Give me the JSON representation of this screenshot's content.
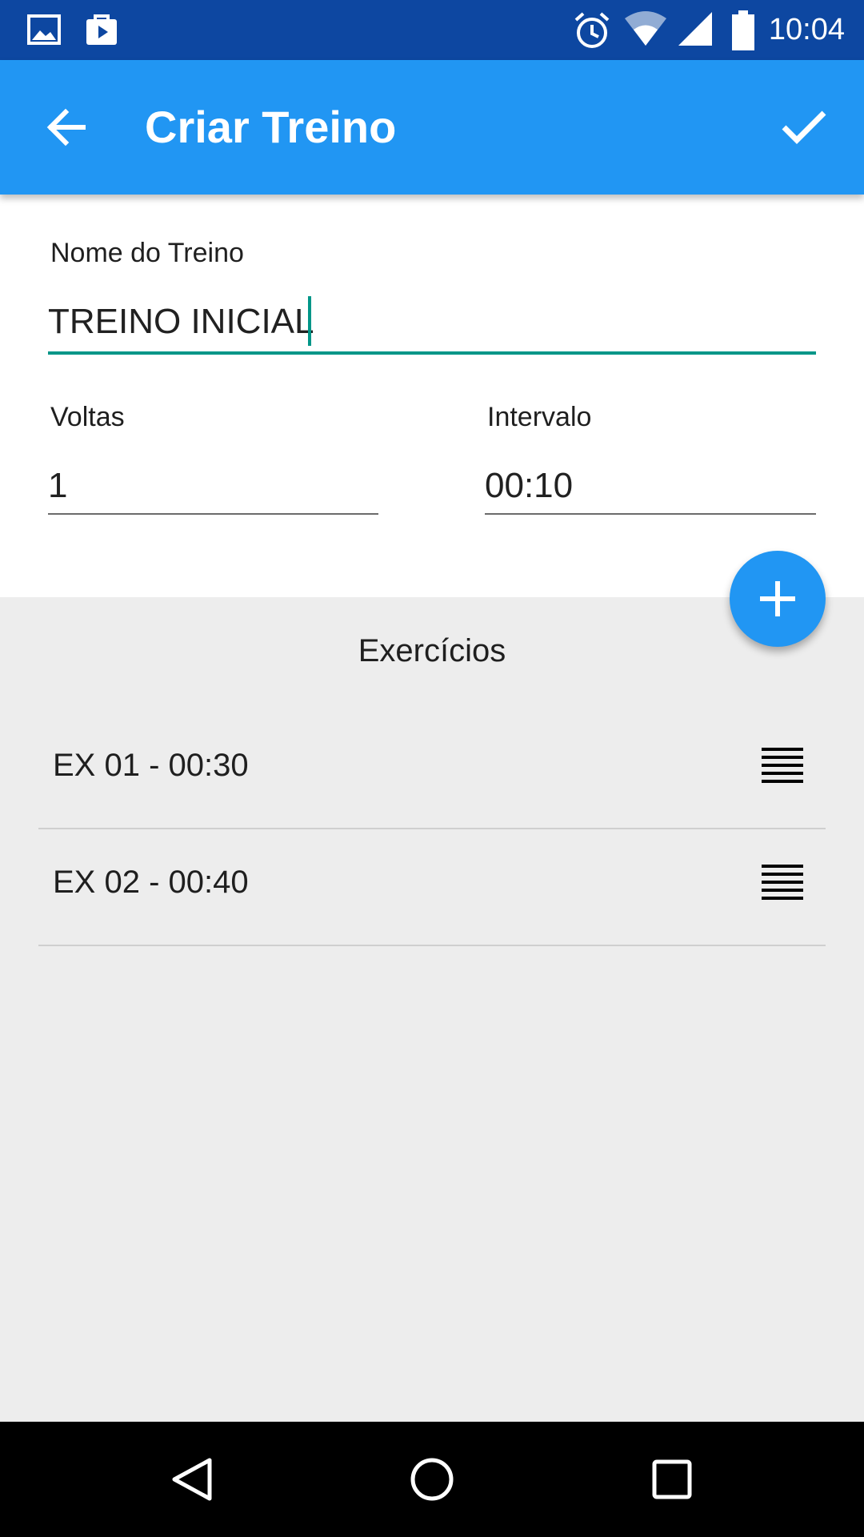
{
  "status_bar": {
    "time": "10:04",
    "left_icons": [
      "image-icon",
      "play-store-icon"
    ],
    "right_icons": [
      "alarm-icon",
      "wifi-icon",
      "signal-icon",
      "battery-icon"
    ]
  },
  "app_bar": {
    "title": "Criar Treino",
    "back_icon": "arrow-back-icon",
    "confirm_icon": "check-icon",
    "color": "#2196f3",
    "status_color": "#0d47a1"
  },
  "form": {
    "name_label": "Nome do Treino",
    "name_value": "TREINO INICIAL",
    "laps_label": "Voltas",
    "laps_value": "1",
    "interval_label": "Intervalo",
    "interval_value": "00:10",
    "accent_color": "#009688"
  },
  "fab": {
    "icon": "add-icon"
  },
  "exercises": {
    "title": "Exercícios",
    "items": [
      {
        "label": "EX 01 - 00:30"
      },
      {
        "label": "EX 02 - 00:40"
      }
    ]
  },
  "nav_bar": {
    "icons": [
      "nav-back-icon",
      "nav-home-icon",
      "nav-recents-icon"
    ]
  }
}
